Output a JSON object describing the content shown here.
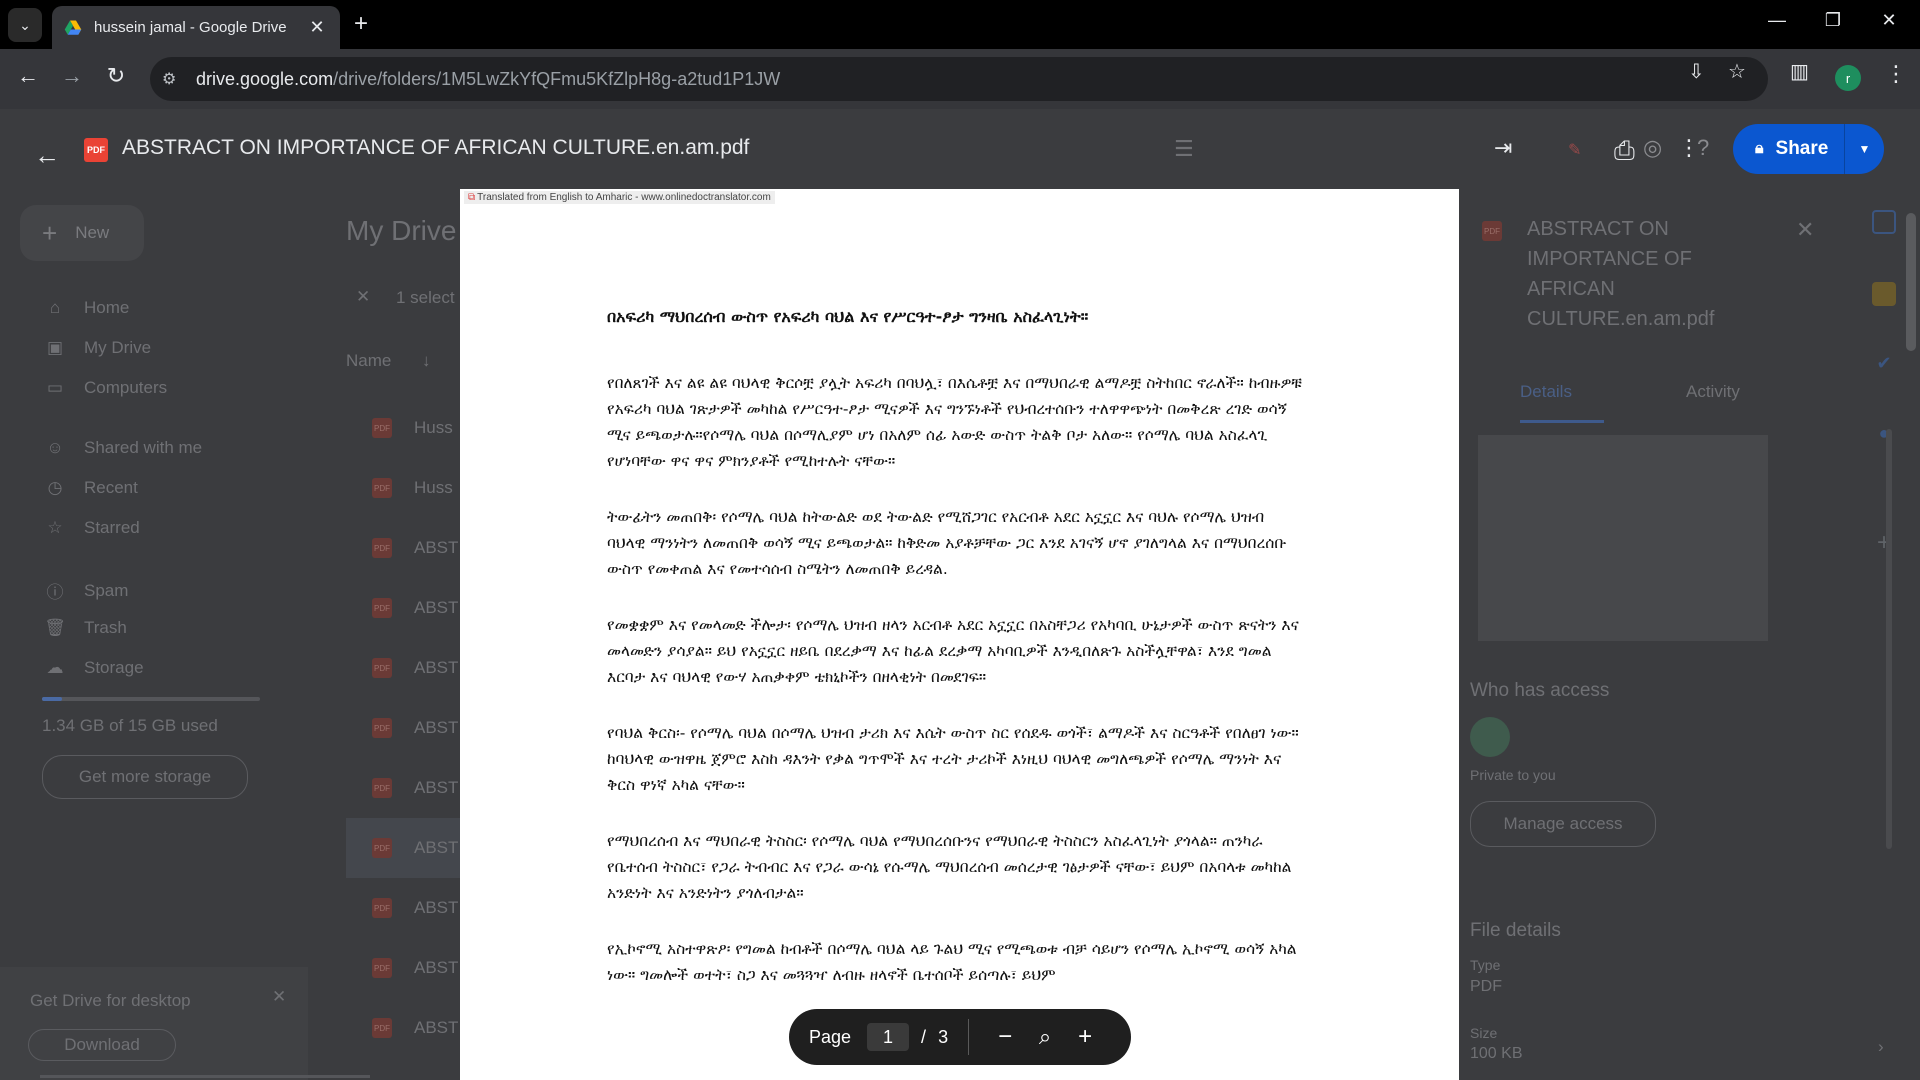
{
  "browser": {
    "tab_title": "hussein jamal - Google Drive",
    "url_host": "drive.google.com",
    "url_path": "/drive/folders/1M5LwZkYfQFmu5KfZlpH8g-a2tud1P1JW",
    "profile_initial": "r"
  },
  "drive_bg": {
    "new_label": "New",
    "nav": [
      "Home",
      "My Drive",
      "Computers",
      "Shared with me",
      "Recent",
      "Starred",
      "Spam",
      "Trash",
      "Storage"
    ],
    "storage_text": "1.34 GB of 15 GB used",
    "storage_fraction": 0.09,
    "get_storage": "Get more storage",
    "promo_title": "Get Drive for desktop",
    "promo_button": "Download",
    "my_drive_title": "My Drive",
    "selected_text": "1 select",
    "name_header": "Name",
    "file_rows": [
      "Huss",
      "Huss",
      "ABST",
      "ABST",
      "ABST",
      "ABST",
      "ABST",
      "ABST",
      "ABST",
      "ABST",
      "ABST"
    ],
    "panel_title": "ABSTRACT ON IMPORTANCE OF AFRICAN CULTURE.en.am.pdf",
    "panel_tabs": [
      "Details",
      "Activity"
    ],
    "who_has_access": "Who has access",
    "private": "Private to you",
    "manage_access": "Manage access",
    "file_details": "File details",
    "type_label": "Type",
    "type_value": "PDF",
    "size_label": "Size",
    "size_value": "100 KB"
  },
  "viewer": {
    "file_title": "ABSTRACT ON IMPORTANCE OF AFRICAN CULTURE.en.am.pdf",
    "pdf_badge": "PDF",
    "share_label": "Share",
    "watermark": "Translated from English to Amharic - www.onlinedoctranslator.com",
    "doc_title": "በአፍሪካ ማህበረሰብ ውስጥ የአፍሪካ ባህል እና የሥርዓተ-ፆታ ግንዛቤ አስፈላጊነት።",
    "paragraphs": [
      "የበለጸገች እና ልዩ ልዩ ባህላዊ ቅርሶቿ ያሏት አፍሪካ በባህሏ፣ በእሴቶቿ እና በማህበራዊ ልማዶቿ ስትከበር ኖራለች። ከብዙዎቹ የአፍሪካ ባህል ገጽታዎች መካከል የሥርዓተ-ፆታ ሚናዎች እና ግንኙነቶች የህብረተሰቡን ተለዋዋጭነት በመቅረጽ ረገድ ወሳኝ ሚና ይጫወታሉ።የሶማሌ ባህል በሶማሊያም ሆነ በአለም ሰፊ አውድ ውስጥ ትልቅ ቦታ አለው። የሶማሌ ባህል አስፈላጊ የሆነባቸው ዋና ዋና ምክንያቶች የሚከተሉት ናቸው።",
      "ትውፊትን መጠበቅ፡ የሶማሌ ባህል ከትውልድ ወደ ትውልድ የሚሸጋገር የአርብቶ አደር አኗኗር እና ባህሉ የሶማሌ ህዝብ ባህላዊ ማንነትን ለመጠበቅ ወሳኝ ሚና ይጫወታል። ከቅድመ አያቶቻቸው ጋር እንደ አገናኝ ሆኖ ያገለግላል እና በማህበረሰቡ ውስጥ የመቀጠል እና የመተሳሰብ ስሜትን ለመጠበቅ ይረዳል.",
      "የመቋቋም እና የመላመድ ችሎታ፡ የሶማሌ ህዝብ ዘላን አርብቶ አደር አኗኗር በአስቸጋሪ የአካባቢ ሁኔታዎች ውስጥ ጽናትን እና መላመድን ያሳያል። ይህ የአኗኗር ዘይቤ በደረቃማ እና ከፊል ደረቃማ አካባቢዎች እንዲበለጽጉ አስችሏቸዋል፣ እንደ ግመል እርባታ እና ባህላዊ የውሃ አጠቃቀም ቴክኒኮችን በዘላቂነት በመደገፍ።",
      "የባህል ቅርስ፡- የሶማሌ ባህል በሶማሌ ህዝብ ታሪክ እና እሴት ውስጥ ስር የሰደዱ ወጎች፣ ልማዶች እና ስርዓቶች የበለፀገ ነው። ከባህላዊ ውዝዋዜ ጀምሮ እስከ ዳእንት የቃል ግጥሞች እና ተረት ታሪኮች እነዚህ ባህላዊ መግለጫዎች የሶማሌ ማንነት እና ቅርስ ዋነኛ አካል ናቸው።",
      "የማህበረሰብ እና ማህበራዊ ትስስር፡ የሶማሌ ባህል የማህበረሰቡንና የማህበራዊ ትስስርን አስፈላጊነት ያጎላል። ጠንካራ የቤተሰብ ትስስር፣ የጋራ ትብብር እና የጋራ ውሳኔ የሱማሌ ማህበረሰብ መሰረታዊ ገፅታዎች ናቸው፣ ይህም በአባላቱ መካከል አንድነት እና አንድነትን ያጎለብታል።",
      "የኢኮኖሚ አስተዋጽዖ፡ የግመል ከብቶች በሶማሌ ባህል ላይ ጉልህ ሚና የሚጫወቱ ብቻ ሳይሆን የሶማሌ ኢኮኖሚ ወሳኝ አካል ነው። ግመሎች ወተት፣ ስጋ እና መጓጓዣ ለብዙ ዘላኖች ቤተሰቦች ይሰጣሉ፣ ይህም"
    ],
    "page_label": "Page",
    "current_page": "1",
    "page_separator": "/",
    "total_pages": "3"
  }
}
